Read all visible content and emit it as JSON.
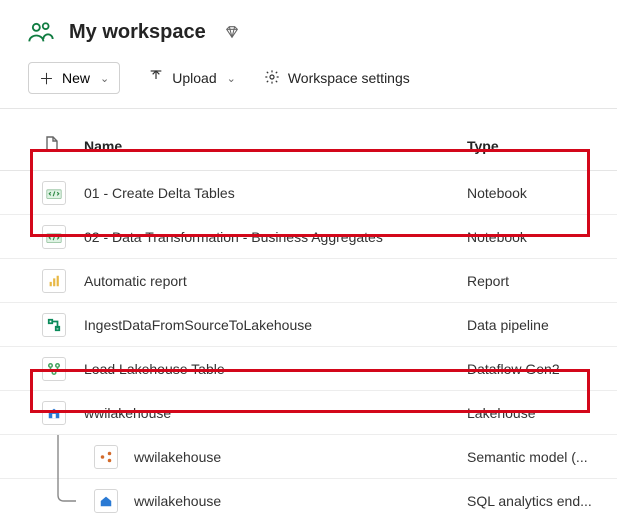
{
  "header": {
    "title": "My workspace"
  },
  "toolbar": {
    "new_label": "New",
    "upload_label": "Upload",
    "settings_label": "Workspace settings"
  },
  "columns": {
    "name": "Name",
    "type": "Type"
  },
  "items": [
    {
      "name": "01 - Create Delta Tables",
      "type": "Notebook",
      "icon": "notebook-icon"
    },
    {
      "name": "02 - Data Transformation - Business Aggregates",
      "type": "Notebook",
      "icon": "notebook-icon"
    },
    {
      "name": "Automatic report",
      "type": "Report",
      "icon": "report-icon"
    },
    {
      "name": "IngestDataFromSourceToLakehouse",
      "type": "Data pipeline",
      "icon": "pipeline-icon"
    },
    {
      "name": "Load Lakehouse Table",
      "type": "Dataflow Gen2",
      "icon": "dataflow-icon"
    },
    {
      "name": "wwilakehouse",
      "type": "Lakehouse",
      "icon": "lakehouse-icon"
    }
  ],
  "children": [
    {
      "name": "wwilakehouse",
      "type": "Semantic model (...",
      "icon": "semantic-model-icon"
    },
    {
      "name": "wwilakehouse",
      "type": "SQL analytics end...",
      "icon": "sql-endpoint-icon"
    }
  ]
}
